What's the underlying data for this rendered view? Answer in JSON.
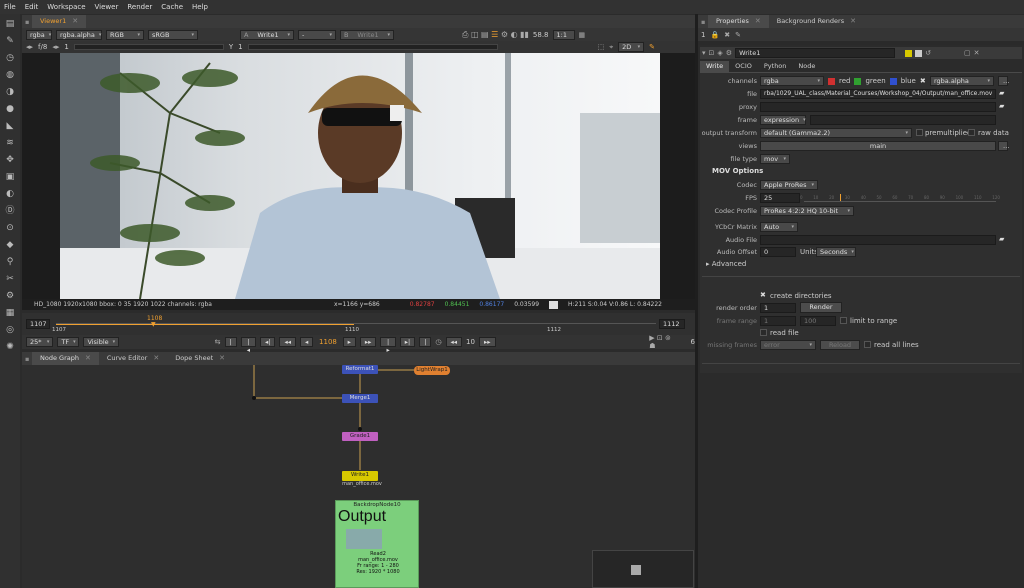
{
  "menu": [
    "File",
    "Edit",
    "Workspace",
    "Viewer",
    "Render",
    "Cache",
    "Help"
  ],
  "viewer": {
    "tab": "Viewer1",
    "channels": "rgba",
    "alpha": "rgba.alpha",
    "colorspace": "RGB",
    "lut": "sRGB",
    "inputA_label": "A",
    "inputA": "Write1",
    "inputMid": "-",
    "inputB_label": "B",
    "inputB": "Write1",
    "fps": "58.8",
    "zoom_ratio": "1:1",
    "mode": "2D",
    "fstop": "f/8",
    "frame_field": "1",
    "y_label": "Y",
    "y_value": "1",
    "info_left": "HD_1080 1920x1080  bbox: 0 35 1920 1022 channels: rgba",
    "coords": "x=1166 y=686",
    "r": "0.82787",
    "g": "0.84451",
    "b": "0.86177",
    "a": "0.03599",
    "hsv": "H:211 S:0.04 V:0.86  L: 0.84222"
  },
  "timeline": {
    "start": "1107",
    "end": "1112",
    "current": "1108",
    "ticks": [
      "1107",
      "1110",
      "1112"
    ],
    "zoom": "25*",
    "tf": "TF",
    "visible": "Visible",
    "frame": "1108",
    "inc": "10",
    "step": "6"
  },
  "graph_tabs": [
    "Node Graph",
    "Curve Editor",
    "Dope Sheet"
  ],
  "nodes": {
    "n1": "Reformat1",
    "n2": "LightWrap1",
    "n3": "Merge1",
    "n4": "Grade1",
    "write": "Write1",
    "write_sub": "man_office.mov",
    "backdrop": "BackdropNode10",
    "backdrop_title": "Output",
    "read": "Read2",
    "read_file": "man_office.mov",
    "read_range": "Fr range: 1 - 280",
    "read_res": "Res: 1920 * 1080"
  },
  "properties": {
    "tabs": [
      "Properties",
      "Background Renders"
    ],
    "count": "1",
    "node_name": "Write1",
    "sub_tabs": [
      "Write",
      "OCIO",
      "Python",
      "Node"
    ],
    "channels_label": "channels",
    "channels_value": "rgba",
    "ch_red": "red",
    "ch_green": "green",
    "ch_blue": "blue",
    "ch_alpha": "rgba.alpha",
    "file_label": "file",
    "file_value": "rba/1029_UAL_class/Material_Courses/Workshop_04/Output/man_office.mov",
    "proxy_label": "proxy",
    "frame_label": "frame",
    "frame_value": "expression",
    "ot_label": "output transform",
    "ot_value": "default (Gamma2.2)",
    "premult": "premultiplied",
    "rawdata": "raw data",
    "views_label": "views",
    "views_value": "main",
    "filetype_label": "file type",
    "filetype_value": "mov",
    "mov_options": "MOV Options",
    "codec_label": "Codec",
    "codec_value": "Apple ProRes",
    "fps_label": "FPS",
    "fps_value": "25",
    "fps_ticks": [
      "0",
      "10",
      "20",
      "30",
      "40",
      "50",
      "60",
      "70",
      "80",
      "90",
      "100",
      "110",
      "120"
    ],
    "profile_label": "Codec Profile",
    "profile_value": "ProRes 4:2:2 HQ 10-bit",
    "ycbcr_label": "YCbCr Matrix",
    "ycbcr_value": "Auto",
    "audio_label": "Audio File",
    "offset_label": "Audio Offset",
    "offset_value": "0",
    "units_label": "Units",
    "units_value": "Seconds",
    "advanced": "Advanced",
    "create_dirs": "create directories",
    "order_label": "render order",
    "order_value": "1",
    "render_btn": "Render",
    "range_label": "frame range",
    "range_a": "1",
    "range_b": "100",
    "limit": "limit to range",
    "read_file": "read file",
    "missing_label": "missing frames",
    "missing_value": "error",
    "reload": "Reload",
    "read_all": "read all lines"
  },
  "colors": {
    "accent": "#f0a030",
    "write_node": "#d8c900",
    "merge_node": "#3c52b8",
    "grade_node": "#c060c0",
    "backdrop": "#7ccf7c"
  }
}
